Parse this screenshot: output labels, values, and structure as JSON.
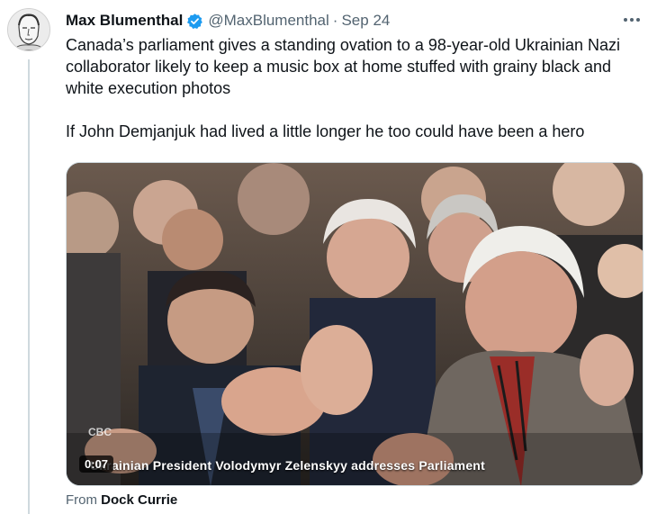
{
  "author": {
    "name": "Max Blumenthal",
    "handle": "@MaxBlumenthal",
    "separator": "·",
    "date": "Sep 24"
  },
  "tweet": {
    "paragraph1": "Canada’s parliament gives a standing ovation to a 98-year-old Ukrainian Nazi collaborator likely to keep a music box at home stuffed with grainy black and white execution photos",
    "paragraph2": "If John Demjanjuk had lived a little longer he too could have been a hero"
  },
  "video": {
    "timestamp": "0:07",
    "watermark": "CBC",
    "caption": "Ukrainian President Volodymyr Zelenskyy addresses Parliament"
  },
  "source": {
    "prefix": "From",
    "name": "Dock Currie"
  },
  "colors": {
    "text": "#0f1419",
    "secondary": "#536471",
    "verified": "#1d9bf0",
    "thread_line": "#cfd9de"
  },
  "icons": {
    "verified": "verified-badge-icon",
    "more": "more-options-icon"
  }
}
